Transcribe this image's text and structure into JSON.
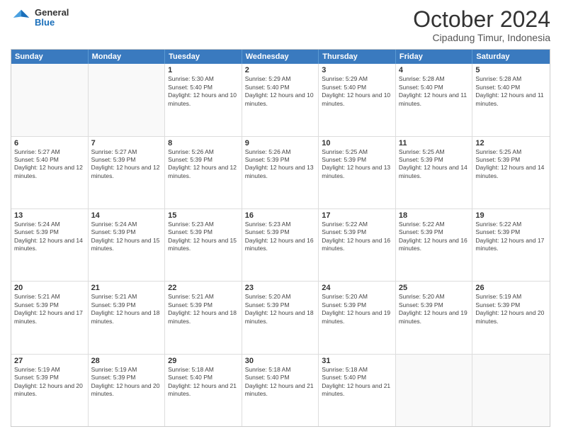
{
  "header": {
    "logo": {
      "general": "General",
      "blue": "Blue"
    },
    "title": "October 2024",
    "subtitle": "Cipadung Timur, Indonesia"
  },
  "calendar": {
    "days_of_week": [
      "Sunday",
      "Monday",
      "Tuesday",
      "Wednesday",
      "Thursday",
      "Friday",
      "Saturday"
    ],
    "rows": [
      [
        {
          "day": "",
          "empty": true
        },
        {
          "day": "",
          "empty": true
        },
        {
          "day": "1",
          "sunrise": "Sunrise: 5:30 AM",
          "sunset": "Sunset: 5:40 PM",
          "daylight": "Daylight: 12 hours and 10 minutes."
        },
        {
          "day": "2",
          "sunrise": "Sunrise: 5:29 AM",
          "sunset": "Sunset: 5:40 PM",
          "daylight": "Daylight: 12 hours and 10 minutes."
        },
        {
          "day": "3",
          "sunrise": "Sunrise: 5:29 AM",
          "sunset": "Sunset: 5:40 PM",
          "daylight": "Daylight: 12 hours and 10 minutes."
        },
        {
          "day": "4",
          "sunrise": "Sunrise: 5:28 AM",
          "sunset": "Sunset: 5:40 PM",
          "daylight": "Daylight: 12 hours and 11 minutes."
        },
        {
          "day": "5",
          "sunrise": "Sunrise: 5:28 AM",
          "sunset": "Sunset: 5:40 PM",
          "daylight": "Daylight: 12 hours and 11 minutes."
        }
      ],
      [
        {
          "day": "6",
          "sunrise": "Sunrise: 5:27 AM",
          "sunset": "Sunset: 5:40 PM",
          "daylight": "Daylight: 12 hours and 12 minutes."
        },
        {
          "day": "7",
          "sunrise": "Sunrise: 5:27 AM",
          "sunset": "Sunset: 5:39 PM",
          "daylight": "Daylight: 12 hours and 12 minutes."
        },
        {
          "day": "8",
          "sunrise": "Sunrise: 5:26 AM",
          "sunset": "Sunset: 5:39 PM",
          "daylight": "Daylight: 12 hours and 12 minutes."
        },
        {
          "day": "9",
          "sunrise": "Sunrise: 5:26 AM",
          "sunset": "Sunset: 5:39 PM",
          "daylight": "Daylight: 12 hours and 13 minutes."
        },
        {
          "day": "10",
          "sunrise": "Sunrise: 5:25 AM",
          "sunset": "Sunset: 5:39 PM",
          "daylight": "Daylight: 12 hours and 13 minutes."
        },
        {
          "day": "11",
          "sunrise": "Sunrise: 5:25 AM",
          "sunset": "Sunset: 5:39 PM",
          "daylight": "Daylight: 12 hours and 14 minutes."
        },
        {
          "day": "12",
          "sunrise": "Sunrise: 5:25 AM",
          "sunset": "Sunset: 5:39 PM",
          "daylight": "Daylight: 12 hours and 14 minutes."
        }
      ],
      [
        {
          "day": "13",
          "sunrise": "Sunrise: 5:24 AM",
          "sunset": "Sunset: 5:39 PM",
          "daylight": "Daylight: 12 hours and 14 minutes."
        },
        {
          "day": "14",
          "sunrise": "Sunrise: 5:24 AM",
          "sunset": "Sunset: 5:39 PM",
          "daylight": "Daylight: 12 hours and 15 minutes."
        },
        {
          "day": "15",
          "sunrise": "Sunrise: 5:23 AM",
          "sunset": "Sunset: 5:39 PM",
          "daylight": "Daylight: 12 hours and 15 minutes."
        },
        {
          "day": "16",
          "sunrise": "Sunrise: 5:23 AM",
          "sunset": "Sunset: 5:39 PM",
          "daylight": "Daylight: 12 hours and 16 minutes."
        },
        {
          "day": "17",
          "sunrise": "Sunrise: 5:22 AM",
          "sunset": "Sunset: 5:39 PM",
          "daylight": "Daylight: 12 hours and 16 minutes."
        },
        {
          "day": "18",
          "sunrise": "Sunrise: 5:22 AM",
          "sunset": "Sunset: 5:39 PM",
          "daylight": "Daylight: 12 hours and 16 minutes."
        },
        {
          "day": "19",
          "sunrise": "Sunrise: 5:22 AM",
          "sunset": "Sunset: 5:39 PM",
          "daylight": "Daylight: 12 hours and 17 minutes."
        }
      ],
      [
        {
          "day": "20",
          "sunrise": "Sunrise: 5:21 AM",
          "sunset": "Sunset: 5:39 PM",
          "daylight": "Daylight: 12 hours and 17 minutes."
        },
        {
          "day": "21",
          "sunrise": "Sunrise: 5:21 AM",
          "sunset": "Sunset: 5:39 PM",
          "daylight": "Daylight: 12 hours and 18 minutes."
        },
        {
          "day": "22",
          "sunrise": "Sunrise: 5:21 AM",
          "sunset": "Sunset: 5:39 PM",
          "daylight": "Daylight: 12 hours and 18 minutes."
        },
        {
          "day": "23",
          "sunrise": "Sunrise: 5:20 AM",
          "sunset": "Sunset: 5:39 PM",
          "daylight": "Daylight: 12 hours and 18 minutes."
        },
        {
          "day": "24",
          "sunrise": "Sunrise: 5:20 AM",
          "sunset": "Sunset: 5:39 PM",
          "daylight": "Daylight: 12 hours and 19 minutes."
        },
        {
          "day": "25",
          "sunrise": "Sunrise: 5:20 AM",
          "sunset": "Sunset: 5:39 PM",
          "daylight": "Daylight: 12 hours and 19 minutes."
        },
        {
          "day": "26",
          "sunrise": "Sunrise: 5:19 AM",
          "sunset": "Sunset: 5:39 PM",
          "daylight": "Daylight: 12 hours and 20 minutes."
        }
      ],
      [
        {
          "day": "27",
          "sunrise": "Sunrise: 5:19 AM",
          "sunset": "Sunset: 5:39 PM",
          "daylight": "Daylight: 12 hours and 20 minutes."
        },
        {
          "day": "28",
          "sunrise": "Sunrise: 5:19 AM",
          "sunset": "Sunset: 5:39 PM",
          "daylight": "Daylight: 12 hours and 20 minutes."
        },
        {
          "day": "29",
          "sunrise": "Sunrise: 5:18 AM",
          "sunset": "Sunset: 5:40 PM",
          "daylight": "Daylight: 12 hours and 21 minutes."
        },
        {
          "day": "30",
          "sunrise": "Sunrise: 5:18 AM",
          "sunset": "Sunset: 5:40 PM",
          "daylight": "Daylight: 12 hours and 21 minutes."
        },
        {
          "day": "31",
          "sunrise": "Sunrise: 5:18 AM",
          "sunset": "Sunset: 5:40 PM",
          "daylight": "Daylight: 12 hours and 21 minutes."
        },
        {
          "day": "",
          "empty": true
        },
        {
          "day": "",
          "empty": true
        }
      ]
    ]
  }
}
